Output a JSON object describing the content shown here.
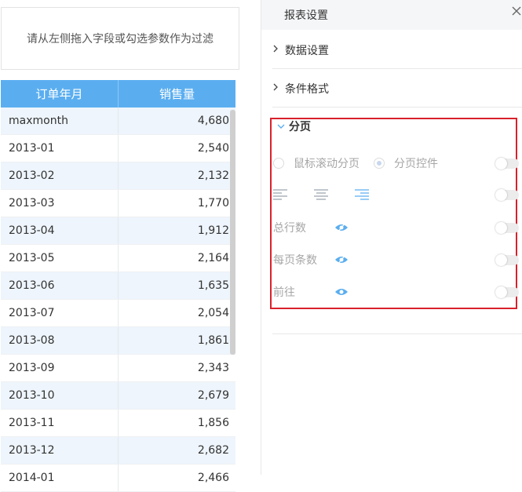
{
  "filter": {
    "placeholder_text": "请从左侧拖入字段或勾选参数作为过滤"
  },
  "table": {
    "headers": [
      "订单年月",
      "销售量"
    ],
    "rows": [
      [
        "maxmonth",
        "4,680"
      ],
      [
        "2013-01",
        "2,540"
      ],
      [
        "2013-02",
        "2,132"
      ],
      [
        "2013-03",
        "1,770"
      ],
      [
        "2013-04",
        "1,912"
      ],
      [
        "2013-05",
        "2,164"
      ],
      [
        "2013-06",
        "1,635"
      ],
      [
        "2013-07",
        "2,054"
      ],
      [
        "2013-08",
        "1,861"
      ],
      [
        "2013-09",
        "2,343"
      ],
      [
        "2013-10",
        "2,679"
      ],
      [
        "2013-11",
        "1,856"
      ],
      [
        "2013-12",
        "2,682"
      ],
      [
        "2014-01",
        "2,466"
      ]
    ]
  },
  "panel": {
    "title": "报表设置",
    "close_icon": "close-icon",
    "sections": [
      {
        "label": "数据设置"
      },
      {
        "label": "条件格式"
      }
    ],
    "pagination": {
      "title": "分页",
      "mode_options": [
        "鼠标滚动分页",
        "分页控件"
      ],
      "selected_mode": "分页控件",
      "alignment_icons": [
        "align-left-icon",
        "align-center-icon",
        "align-right-icon"
      ],
      "selected_alignment": "align-right-icon",
      "items": [
        {
          "label": "总行数",
          "icon": "eye-icon"
        },
        {
          "label": "每页条数",
          "icon": "eye-icon"
        },
        {
          "label": "前往",
          "icon": "eye-icon"
        }
      ]
    }
  },
  "colors": {
    "header_blue": "#5aaef0",
    "highlight_red": "#d9212c",
    "accent_blue": "#5aaef0"
  }
}
